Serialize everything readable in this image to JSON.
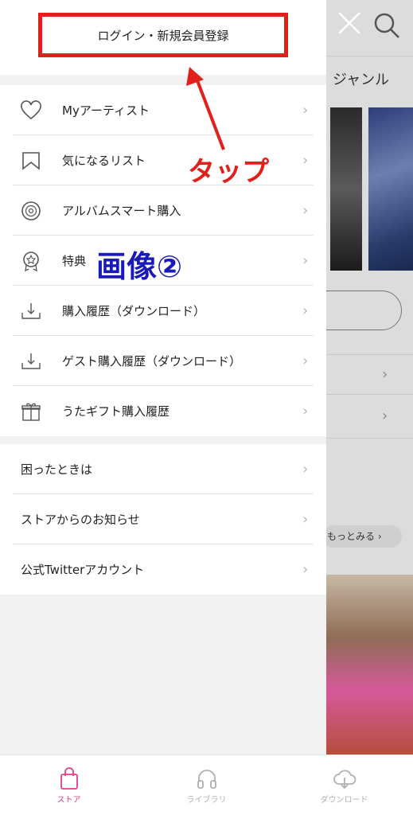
{
  "background": {
    "genre_label": "ジャンル",
    "more_label": "もっとみる",
    "close_icon": "close-icon",
    "search_icon": "search-icon"
  },
  "drawer": {
    "login_label": "ログイン・新規会員登録",
    "menu_items": [
      {
        "label": "Myアーティスト",
        "icon": "heart-icon"
      },
      {
        "label": "気になるリスト",
        "icon": "bookmark-icon"
      },
      {
        "label": "アルバムスマート購入",
        "icon": "disc-icon"
      },
      {
        "label": "特典",
        "icon": "award-icon"
      },
      {
        "label": "購入履歴（ダウンロード）",
        "icon": "download-tray-icon"
      },
      {
        "label": "ゲスト購入履歴（ダウンロード）",
        "icon": "download-tray-icon"
      },
      {
        "label": "うたギフト購入履歴",
        "icon": "gift-icon"
      }
    ],
    "support_items": [
      {
        "label": "困ったときは"
      },
      {
        "label": "ストアからのお知らせ"
      },
      {
        "label": "公式Twitterアカウント"
      }
    ],
    "chevron": "›"
  },
  "annotations": {
    "tap": "タップ",
    "image_label": "画像②",
    "color_red": "#e0201b",
    "color_blue": "#1a1ab8"
  },
  "tabbar": {
    "tabs": [
      {
        "label": "ストア",
        "icon": "shopping-bag-icon",
        "active": true,
        "color": "#e23d8a"
      },
      {
        "label": "ライブラリ",
        "icon": "headphones-icon",
        "active": false,
        "color": "#b0b0b0"
      },
      {
        "label": "ダウンロード",
        "icon": "cloud-download-icon",
        "active": false,
        "color": "#b0b0b0"
      }
    ]
  }
}
